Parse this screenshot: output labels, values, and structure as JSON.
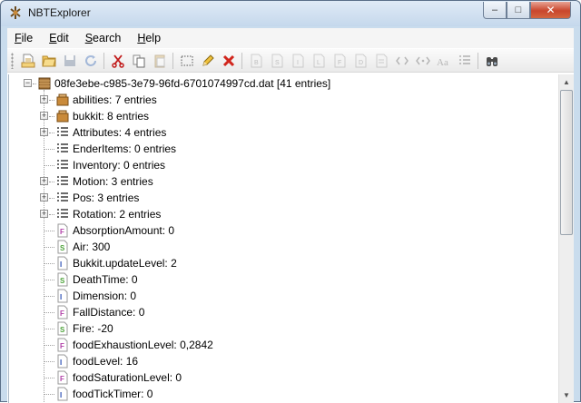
{
  "window": {
    "title": "NBTExplorer",
    "close_glyph": "✕",
    "minimize_glyph": "–",
    "maximize_glyph": "□"
  },
  "menu": [
    {
      "key": "file",
      "mnemonic": "F",
      "rest": "ile"
    },
    {
      "key": "edit",
      "mnemonic": "E",
      "rest": "dit"
    },
    {
      "key": "search",
      "mnemonic": "S",
      "rest": "earch"
    },
    {
      "key": "help",
      "mnemonic": "H",
      "rest": "elp"
    }
  ],
  "toolbar": [
    {
      "icon": "new-file-icon",
      "enabled": true
    },
    {
      "icon": "open-folder-icon",
      "enabled": true
    },
    {
      "icon": "save-icon",
      "enabled": false
    },
    {
      "icon": "refresh-icon",
      "enabled": false
    },
    {
      "sep": true
    },
    {
      "icon": "cut-icon",
      "enabled": true
    },
    {
      "icon": "copy-icon",
      "enabled": true
    },
    {
      "icon": "paste-icon",
      "enabled": false
    },
    {
      "sep": true
    },
    {
      "icon": "rename-icon",
      "enabled": true
    },
    {
      "icon": "edit-pencil-icon",
      "enabled": true
    },
    {
      "icon": "delete-icon",
      "enabled": true
    },
    {
      "sep": true
    },
    {
      "icon": "add-byte-icon",
      "enabled": false
    },
    {
      "icon": "add-short-icon",
      "enabled": false
    },
    {
      "icon": "add-int-icon",
      "enabled": false
    },
    {
      "icon": "add-long-icon",
      "enabled": false
    },
    {
      "icon": "add-float-icon",
      "enabled": false
    },
    {
      "icon": "add-double-icon",
      "enabled": false
    },
    {
      "icon": "add-byte-array-icon",
      "enabled": false
    },
    {
      "icon": "add-int-array-icon",
      "enabled": false
    },
    {
      "icon": "add-string-icon",
      "enabled": false
    },
    {
      "icon": "add-list-icon",
      "enabled": false
    },
    {
      "icon": "add-compound-icon",
      "enabled": false
    },
    {
      "sep": true
    },
    {
      "icon": "find-binoculars-icon",
      "enabled": true
    }
  ],
  "colors": {
    "tag_compound": "#c98a3a",
    "tag_list": "#3a3a3a",
    "tag_float": "#b13fa8",
    "tag_short": "#4fa33c",
    "tag_int": "#2c4fb5",
    "delete_red": "#d1261d",
    "titlebar": "#c5d8ec"
  },
  "tree": {
    "root": {
      "label": "08fe3ebe-c985-3e79-96fd-6701074997cd.dat [41 entries]",
      "type": "file",
      "expanded": true
    },
    "children": [
      {
        "label": "abilities: 7 entries",
        "type": "compound",
        "expandable": true
      },
      {
        "label": "bukkit: 8 entries",
        "type": "compound",
        "expandable": true
      },
      {
        "label": "Attributes: 4 entries",
        "type": "list",
        "expandable": true
      },
      {
        "label": "EnderItems: 0 entries",
        "type": "list",
        "expandable": false
      },
      {
        "label": "Inventory: 0 entries",
        "type": "list",
        "expandable": false
      },
      {
        "label": "Motion: 3 entries",
        "type": "list",
        "expandable": true
      },
      {
        "label": "Pos: 3 entries",
        "type": "list",
        "expandable": true
      },
      {
        "label": "Rotation: 2 entries",
        "type": "list",
        "expandable": true
      },
      {
        "label": "AbsorptionAmount: 0",
        "type": "float",
        "expandable": false
      },
      {
        "label": "Air: 300",
        "type": "short",
        "expandable": false
      },
      {
        "label": "Bukkit.updateLevel: 2",
        "type": "int",
        "expandable": false
      },
      {
        "label": "DeathTime: 0",
        "type": "short",
        "expandable": false
      },
      {
        "label": "Dimension: 0",
        "type": "int",
        "expandable": false
      },
      {
        "label": "FallDistance: 0",
        "type": "float",
        "expandable": false
      },
      {
        "label": "Fire: -20",
        "type": "short",
        "expandable": false
      },
      {
        "label": "foodExhaustionLevel: 0,2842",
        "type": "float",
        "expandable": false
      },
      {
        "label": "foodLevel: 16",
        "type": "int",
        "expandable": false
      },
      {
        "label": "foodSaturationLevel: 0",
        "type": "float",
        "expandable": false
      },
      {
        "label": "foodTickTimer: 0",
        "type": "int",
        "expandable": false
      }
    ]
  },
  "tag_letters": {
    "float": "F",
    "short": "S",
    "int": "I"
  }
}
